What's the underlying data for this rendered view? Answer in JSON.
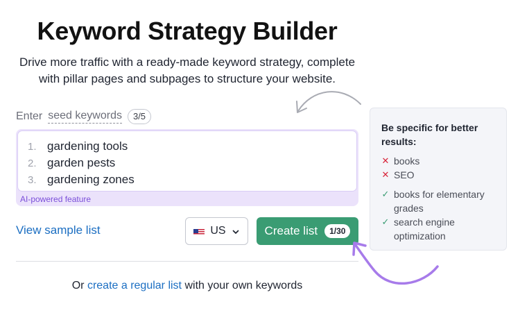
{
  "header": {
    "title": "Keyword Strategy Builder",
    "subtitle_line1": "Drive more traffic with a ready-made keyword strategy, complete",
    "subtitle_line2": "with pillar pages and subpages to structure your website."
  },
  "seed": {
    "label_prefix": "Enter",
    "label_link": "seed keywords",
    "count": "3/5",
    "keywords": [
      {
        "num": "1.",
        "text": "gardening tools"
      },
      {
        "num": "2.",
        "text": "garden pests"
      },
      {
        "num": "3.",
        "text": "gardening zones"
      }
    ],
    "ai_label": "AI-powered feature"
  },
  "actions": {
    "sample_link": "View sample list",
    "country": "US",
    "create_label": "Create list",
    "create_badge": "1/30"
  },
  "footer": {
    "prefix": "Or",
    "link": "create a regular list",
    "suffix": "with your own keywords"
  },
  "tips": {
    "title": "Be specific for better results:",
    "bad": [
      "books",
      "SEO"
    ],
    "good": [
      "books for elementary grades",
      "search engine optimization"
    ]
  },
  "colors": {
    "accent_green": "#3a9c73",
    "link_blue": "#1b6ec2",
    "ai_purple": "#7b4fd9",
    "annotation_purple": "#a77bea"
  },
  "icons": {
    "flag": "us-flag-icon",
    "chevron": "chevron-down-icon",
    "cross": "x-icon",
    "check": "check-icon"
  }
}
